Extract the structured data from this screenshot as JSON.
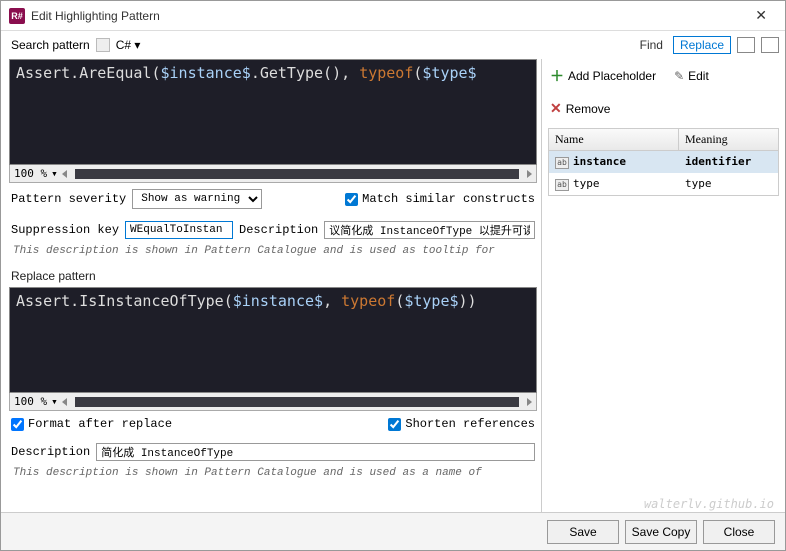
{
  "window": {
    "title": "Edit Highlighting Pattern"
  },
  "toolbar": {
    "search_label": "Search pattern",
    "language": "C#",
    "find": "Find",
    "replace": "Replace"
  },
  "search_editor": {
    "zoom": "100 %",
    "code_plain": "Assert.AreEqual(",
    "code_tpl1": "$instance$",
    "code_mid": ".GetType(), ",
    "code_kw": "typeof",
    "code_open": "(",
    "code_tpl2": "$type$",
    "code_close": "))"
  },
  "severity": {
    "label": "Pattern severity",
    "value": "Show as warning",
    "match_similar_label": "Match similar constructs"
  },
  "suppression": {
    "key_label": "Suppression key",
    "key_value": "WEqualToInstan",
    "desc_label": "Description",
    "desc_value": "议简化成 InstanceOfType 以提升可读性。",
    "hint": "This description is shown in Pattern Catalogue and is used as tooltip for"
  },
  "replace": {
    "section": "Replace pattern",
    "zoom": "100 %",
    "code_plain": "Assert.IsInstanceOfType(",
    "code_tpl1": "$instance$",
    "code_mid": ", ",
    "code_kw": "typeof",
    "code_open": "(",
    "code_tpl2": "$type$",
    "code_close": "))",
    "format_label": "Format after replace",
    "shorten_label": "Shorten references",
    "desc_label": "Description",
    "desc_value": "简化成 InstanceOfType",
    "hint": "This description is shown in Pattern Catalogue and is used as a name of"
  },
  "placeholders": {
    "add": "Add Placeholder",
    "edit": "Edit",
    "remove": "Remove",
    "col_name": "Name",
    "col_meaning": "Meaning",
    "rows": [
      {
        "name": "instance",
        "meaning": "identifier",
        "selected": true
      },
      {
        "name": "type",
        "meaning": "type",
        "selected": false
      }
    ]
  },
  "footer": {
    "save": "Save",
    "save_copy": "Save Copy",
    "close": "Close"
  },
  "watermark": "walterlv.github.io"
}
